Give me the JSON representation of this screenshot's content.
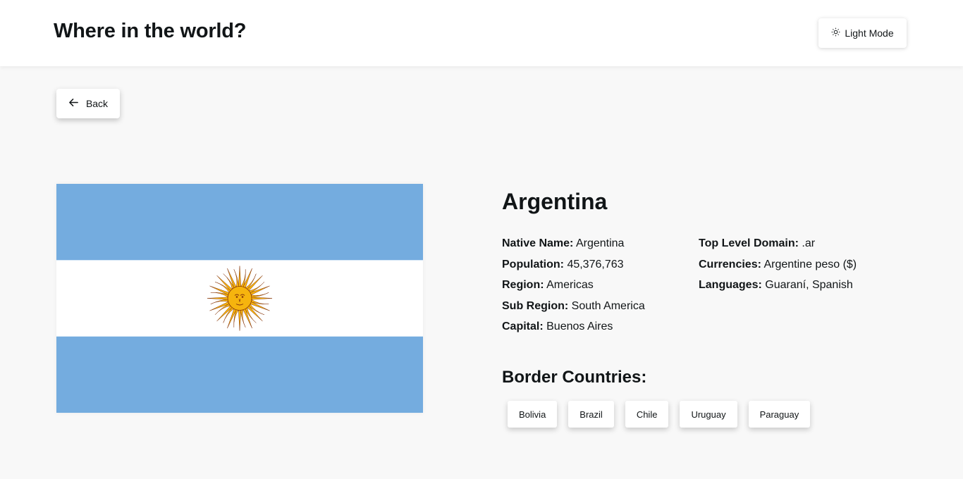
{
  "header": {
    "title": "Where in the world?",
    "mode_label": "Light Mode",
    "mode_icon": "sun-icon"
  },
  "back": {
    "label": "Back",
    "icon": "arrow-left-icon"
  },
  "flag": {
    "description_colors": {
      "blue": "#74acdf",
      "white": "#ffffff",
      "sun": "#f6b40e",
      "sun_outline": "#85340a"
    }
  },
  "country": {
    "name": "Argentina",
    "left_details": [
      {
        "label": "Native Name:",
        "value": "Argentina"
      },
      {
        "label": "Population:",
        "value": "45,376,763"
      },
      {
        "label": "Region:",
        "value": "Americas"
      },
      {
        "label": "Sub Region:",
        "value": "South America"
      },
      {
        "label": "Capital:",
        "value": "Buenos Aires"
      }
    ],
    "right_details": [
      {
        "label": "Top Level Domain:",
        "value": ".ar"
      },
      {
        "label": "Currencies:",
        "value": "Argentine peso ($)"
      },
      {
        "label": "Languages:",
        "value": "Guaraní, Spanish"
      }
    ]
  },
  "borders": {
    "title": "Border Countries:",
    "countries": [
      "Bolivia",
      "Brazil",
      "Chile",
      "Uruguay",
      "Paraguay"
    ]
  }
}
